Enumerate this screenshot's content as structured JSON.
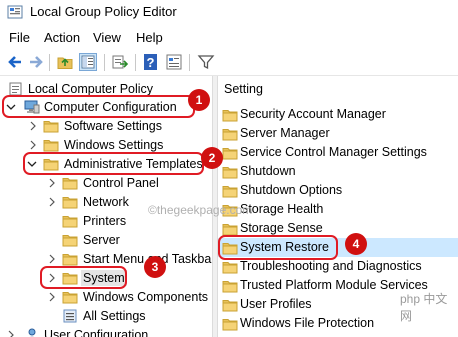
{
  "window": {
    "title": "Local Group Policy Editor",
    "app_icon": "policy-editor-icon"
  },
  "menu": [
    "File",
    "Action",
    "View",
    "Help"
  ],
  "toolbar": {
    "icons": [
      "back-arrow-icon",
      "forward-arrow-icon",
      "up-folder-icon",
      "show-hide-tree-icon",
      "export-list-icon",
      "help-icon",
      "properties-icon",
      "filter-icon"
    ]
  },
  "tree": {
    "root": "Local Computer Policy",
    "computer_config": "Computer Configuration",
    "software_settings": "Software Settings",
    "windows_settings": "Windows Settings",
    "admin_templates": "Administrative Templates",
    "control_panel": "Control Panel",
    "network": "Network",
    "printers": "Printers",
    "server": "Server",
    "start_menu": "Start Menu and Taskbar",
    "system": "System",
    "windows_components": "Windows Components",
    "all_settings": "All Settings",
    "user_config": "User Configuration"
  },
  "list": {
    "header": "Setting",
    "items": [
      "Security Account Manager",
      "Server Manager",
      "Service Control Manager Settings",
      "Shutdown",
      "Shutdown Options",
      "Storage Health",
      "Storage Sense",
      "System Restore",
      "Troubleshooting and Diagnostics",
      "Trusted Platform Module Services",
      "User Profiles",
      "Windows File Protection"
    ],
    "selected": "System Restore"
  },
  "annotations": [
    "1",
    "2",
    "3",
    "4"
  ],
  "watermarks": {
    "center": "©thegeekpage.com",
    "corner": "php 中文网"
  },
  "colors": {
    "highlight_red": "#e01b24",
    "badge_red": "#d01010",
    "selection_blue": "#cce8ff",
    "folder_yellow": "#e8c15a"
  }
}
